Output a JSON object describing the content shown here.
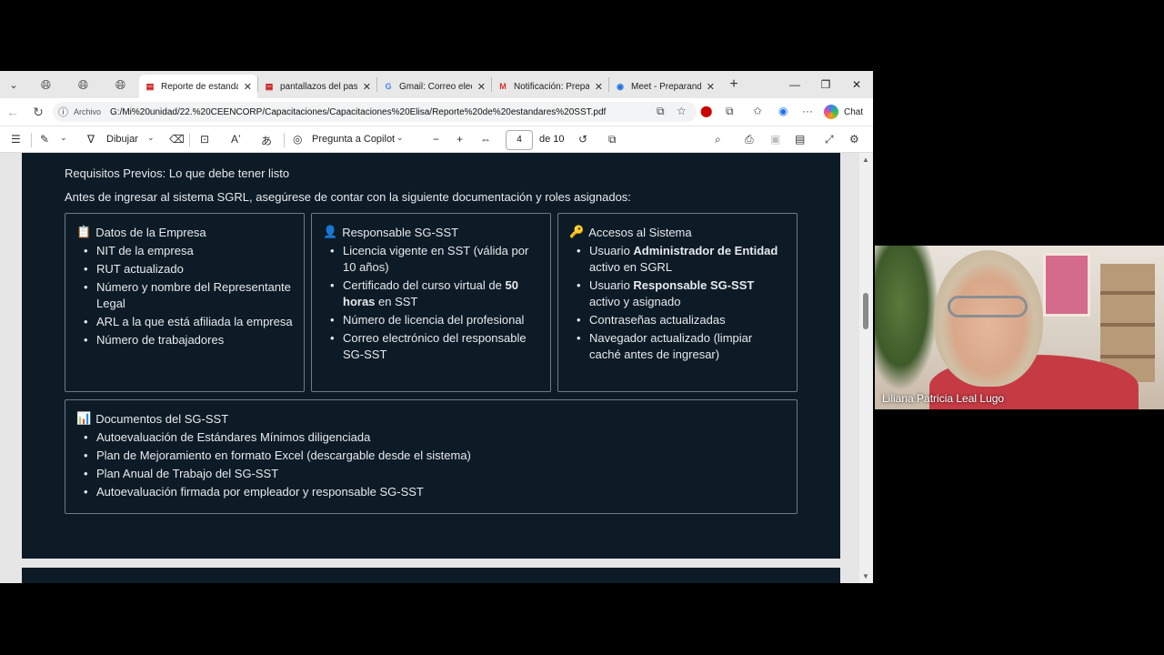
{
  "tabs": [
    {
      "label": "Reporte de estandares",
      "icon": "pdf-icon",
      "active": true
    },
    {
      "label": "pantallazos del paso a",
      "icon": "pdf-icon",
      "active": false
    },
    {
      "label": "Gmail: Correo electróni",
      "icon": "google-icon",
      "active": false
    },
    {
      "label": "Notificación: Prepara",
      "icon": "gmail-icon",
      "active": false
    },
    {
      "label": "Meet - Preparand",
      "icon": "meet-icon",
      "active": false
    }
  ],
  "address": {
    "site": "Archivo",
    "url": "G:/Mi%20unidad/22.%20CEENCORP/Capacitaciones/Capacitaciones%20Elisa/Reporte%20de%20estandares%20SST.pdf",
    "chat": "Chat"
  },
  "pdf_toolbar": {
    "draw": "Dibujar",
    "copilot": "Pregunta a Copilot",
    "page": "4",
    "of_pages": "de 10"
  },
  "doc": {
    "heading": "Requisitos Previos: Lo que debe tener listo",
    "intro": "Antes de ingresar al sistema SGRL, asegúrese de contar con la siguiente documentación y roles asignados:",
    "cards": [
      {
        "emoji": "📋",
        "title": "Datos de la Empresa",
        "items": [
          "NIT de la empresa",
          "RUT actualizado",
          "Número y nombre del Representante Legal",
          "ARL a la que está afiliada la empresa",
          "Número de trabajadores"
        ]
      },
      {
        "emoji": "👤",
        "title": "Responsable SG-SST",
        "items": [
          "Licencia vigente en SST (válida por 10 años)",
          "Certificado del curso virtual de |50 horas| en SST",
          "Número de licencia del profesional",
          "Correo electrónico del responsable SG-SST"
        ]
      },
      {
        "emoji": "🔑",
        "title": "Accesos al Sistema",
        "items": [
          "Usuario |Administrador de Entidad| activo en SGRL",
          "Usuario |Responsable SG-SST| activo y asignado",
          "Contraseñas actualizadas",
          "Navegador actualizado (limpiar caché antes de ingresar)"
        ]
      },
      {
        "emoji": "📊",
        "title": "Documentos del SG-SST",
        "items": [
          "Autoevaluación de Estándares Mínimos diligenciada",
          "Plan de Mejoramiento en formato Excel (descargable desde el sistema)",
          "Plan Anual de Trabajo del SG-SST",
          "Autoevaluación firmada por empleador y responsable SG-SST"
        ]
      }
    ]
  },
  "video": {
    "participant": "Liliana Patricia Leal Lugo"
  }
}
